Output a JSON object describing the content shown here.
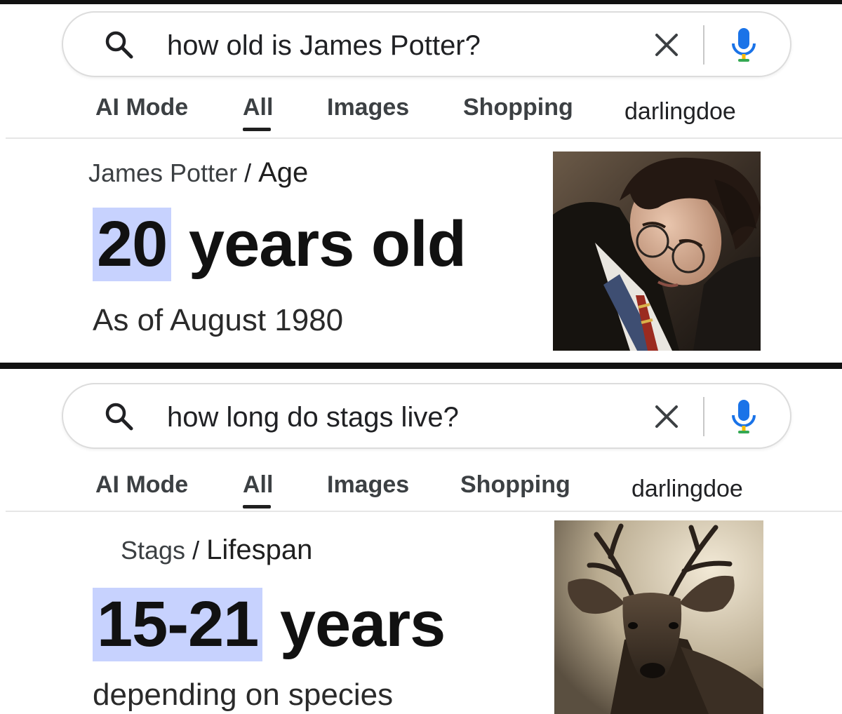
{
  "results": [
    {
      "search": {
        "query": "how old is James Potter?"
      },
      "tabs": [
        {
          "label": "AI Mode",
          "active": false
        },
        {
          "label": "All",
          "active": true
        },
        {
          "label": "Images",
          "active": false
        },
        {
          "label": "Shopping",
          "active": false
        },
        {
          "label": "darlingdoe",
          "active": false
        }
      ],
      "breadcrumb": {
        "entity": "James Potter",
        "separator": " / ",
        "attribute": "Age"
      },
      "answer": {
        "highlight": "20",
        "rest": " years old"
      },
      "subtext": "As of August 1980",
      "image": {
        "icon": "portrait-photo"
      }
    },
    {
      "search": {
        "query": "how long do stags live?"
      },
      "tabs": [
        {
          "label": "AI Mode",
          "active": false
        },
        {
          "label": "All",
          "active": true
        },
        {
          "label": "Images",
          "active": false
        },
        {
          "label": "Shopping",
          "active": false
        },
        {
          "label": "darlingdoe",
          "active": false
        }
      ],
      "breadcrumb": {
        "entity": "Stags",
        "separator": " / ",
        "attribute": "Lifespan"
      },
      "answer": {
        "highlight": "15-21",
        "rest": " years"
      },
      "subtext": "depending on species",
      "image": {
        "icon": "stag-photo"
      }
    }
  ],
  "colors": {
    "highlight": "#c7d2fe",
    "mic_blue": "#1a73e8",
    "mic_yellow": "#fbbc04",
    "divider": "#111111"
  }
}
